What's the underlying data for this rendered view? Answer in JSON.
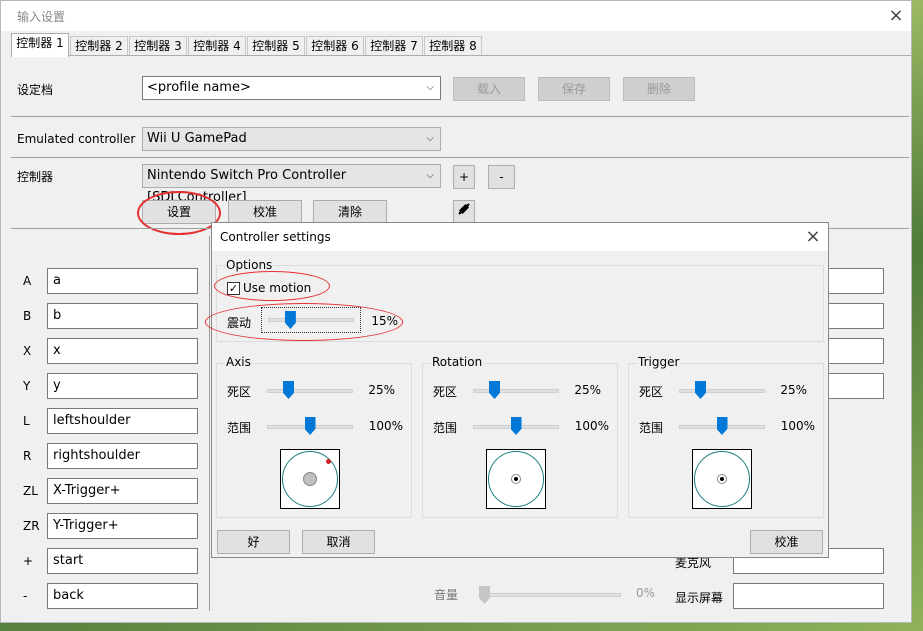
{
  "window": {
    "title": "输入设置",
    "close": "×"
  },
  "tabs": [
    "控制器 1",
    "控制器 2",
    "控制器 3",
    "控制器 4",
    "控制器 5",
    "控制器 6",
    "控制器 7",
    "控制器 8"
  ],
  "profile": {
    "label": "设定档",
    "placeholder": "<profile name>",
    "load": "载入",
    "save": "保存",
    "delete": "删除"
  },
  "emulated": {
    "label": "Emulated controller",
    "value": "Wii U GamePad"
  },
  "controller": {
    "label": "控制器",
    "value": "Nintendo Switch Pro Controller [SDLController]",
    "add": "+",
    "remove": "-",
    "settings": "设置",
    "calibrate": "校准",
    "clear": "清除"
  },
  "mappings": [
    {
      "key": "A",
      "value": "a"
    },
    {
      "key": "B",
      "value": "b"
    },
    {
      "key": "X",
      "value": "x"
    },
    {
      "key": "Y",
      "value": "y"
    },
    {
      "key": "L",
      "value": "leftshoulder"
    },
    {
      "key": "R",
      "value": "rightshoulder"
    },
    {
      "key": "ZL",
      "value": "X-Trigger+"
    },
    {
      "key": "ZR",
      "value": "Y-Trigger+"
    },
    {
      "key": "+",
      "value": "start"
    },
    {
      "key": "-",
      "value": "back"
    }
  ],
  "background_right": {
    "mic_label": "麦克风",
    "screen_label": "显示屏幕",
    "volume_label": "音量",
    "volume_pct": "0%"
  },
  "dialog": {
    "title": "Controller settings",
    "close": "×",
    "options": {
      "title": "Options",
      "use_motion_label": "Use motion",
      "use_motion_checked": "✓",
      "rumble_label": "震动",
      "rumble_pct": "15%",
      "rumble_value": 0.15
    },
    "groups": [
      {
        "title": "Axis",
        "deadzone_label": "死区",
        "deadzone_pct": "25%",
        "deadzone_value": 0.25,
        "range_label": "范围",
        "range_pct": "100%",
        "range_value": 1.0
      },
      {
        "title": "Rotation",
        "deadzone_label": "死区",
        "deadzone_pct": "25%",
        "deadzone_value": 0.25,
        "range_label": "范围",
        "range_pct": "100%",
        "range_value": 1.0
      },
      {
        "title": "Trigger",
        "deadzone_label": "死区",
        "deadzone_pct": "25%",
        "deadzone_value": 0.25,
        "range_label": "范围",
        "range_pct": "100%",
        "range_value": 1.0
      }
    ],
    "ok": "好",
    "cancel": "取消",
    "calibrate": "校准"
  },
  "colors": {
    "accent": "#0078d7",
    "highlight": "#e53030",
    "ring": "#1a7f7f"
  }
}
